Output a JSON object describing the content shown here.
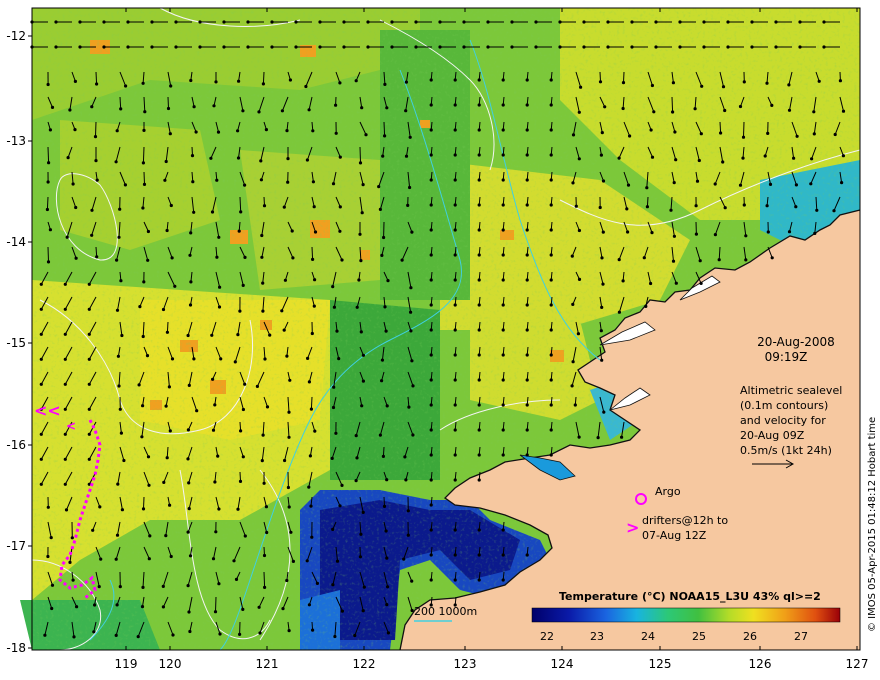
{
  "map": {
    "lon_ticks": [
      "119",
      "120",
      "121",
      "122",
      "123",
      "124",
      "125",
      "126",
      "127"
    ],
    "lat_ticks": [
      "-12",
      "-13",
      "-14",
      "-15",
      "-16",
      "-17",
      "-18"
    ]
  },
  "annotations": {
    "date": "20-Aug-2008",
    "time": "09:19Z",
    "altimetry": [
      "Altimetric sealevel",
      "(0.1m contours)",
      "and velocity for",
      "20-Aug 09Z",
      "0.5m/s (1kt 24h)"
    ],
    "argo_label": "Argo",
    "drifters_line1": "drifters@12h to",
    "drifters_line2": "07-Aug 12Z",
    "isobath_label": "200  1000m"
  },
  "legend": {
    "title": "Temperature (°C) NOAA15_L3U 43% ql>=2",
    "ticks": [
      "22",
      "23",
      "24",
      "25",
      "26",
      "27"
    ]
  },
  "credit": "© IMOS 05-Apr-2015 01:48:12 Hobart time",
  "colors": {
    "land": "#f6c8a0",
    "cold": "#0a1a8c",
    "cyan": "#27b4d8",
    "green": "#33b44a",
    "yellow": "#d8e028",
    "orange": "#f0a020",
    "drifter": "#ff00ff"
  }
}
